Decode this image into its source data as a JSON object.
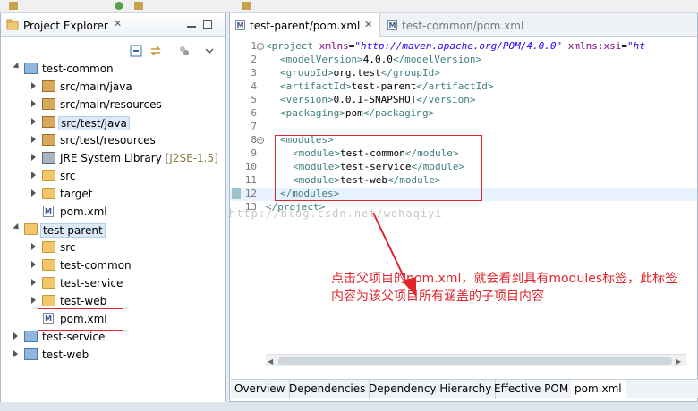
{
  "explorer": {
    "title": "Project Explorer",
    "items": [
      {
        "label": "test-common",
        "decoration": ""
      },
      {
        "label": "src/main/java",
        "decoration": ""
      },
      {
        "label": "src/main/resources",
        "decoration": ""
      },
      {
        "label": "src/test/java",
        "decoration": ""
      },
      {
        "label": "src/test/resources",
        "decoration": ""
      },
      {
        "label": "JRE System Library",
        "decoration": "[J2SE-1.5]"
      },
      {
        "label": "src",
        "decoration": ""
      },
      {
        "label": "target",
        "decoration": ""
      },
      {
        "label": "pom.xml",
        "decoration": ""
      },
      {
        "label": "test-parent",
        "decoration": ""
      },
      {
        "label": "src",
        "decoration": ""
      },
      {
        "label": "test-common",
        "decoration": ""
      },
      {
        "label": "test-service",
        "decoration": ""
      },
      {
        "label": "test-web",
        "decoration": ""
      },
      {
        "label": "pom.xml",
        "decoration": ""
      },
      {
        "label": "test-service",
        "decoration": ""
      },
      {
        "label": "test-web",
        "decoration": ""
      }
    ]
  },
  "editor": {
    "tabs": [
      {
        "label": "test-parent/pom.xml",
        "active": true
      },
      {
        "label": "test-common/pom.xml",
        "active": false
      }
    ],
    "line_numbers": [
      "1",
      "2",
      "3",
      "4",
      "5",
      "6",
      "7",
      "8",
      "9",
      "10",
      "11",
      "12",
      "13"
    ],
    "lines": {
      "l1_a": "<project ",
      "l1_b": "xmlns",
      "l1_c": "=",
      "l1_d": "\"http://maven.apache.org/POM/4.0.0\"",
      "l1_e": " xmlns:xsi",
      "l1_f": "=",
      "l1_g": "\"ht",
      "l2_a": "<modelVersion>",
      "l2_b": "4.0.0",
      "l2_c": "</modelVersion>",
      "l3_a": "<groupId>",
      "l3_b": "org.test",
      "l3_c": "</groupId>",
      "l4_a": "<artifactId>",
      "l4_b": "test-parent",
      "l4_c": "</artifactId>",
      "l5_a": "<version>",
      "l5_b": "0.0.1-SNAPSHOT",
      "l5_c": "</version>",
      "l6_a": "<packaging>",
      "l6_b": "pom",
      "l6_c": "</packaging>",
      "l8_a": "<modules>",
      "l9_a": "<module>",
      "l9_b": "test-common",
      "l9_c": "</module>",
      "l10_a": "<module>",
      "l10_b": "test-service",
      "l10_c": "</module>",
      "l11_a": "<module>",
      "l11_b": "test-web",
      "l11_c": "</module>",
      "l12_a": "</modules>",
      "l13_a": "</project>"
    },
    "watermark": "http://blog.csdn.net/wohaqiyi",
    "annotation": "点击父项目的pom.xml，就会看到具有modules标签，此标签内容为该父项目所有涵盖的子项目内容"
  },
  "bottom_tabs": [
    "Overview",
    "Dependencies",
    "Dependency Hierarchy",
    "Effective POM",
    "pom.xml"
  ],
  "colors": {
    "highlight": "#e0262d",
    "tag": "#3f7f7f",
    "string": "#2a00ff",
    "selection": "#dbe9f9"
  }
}
